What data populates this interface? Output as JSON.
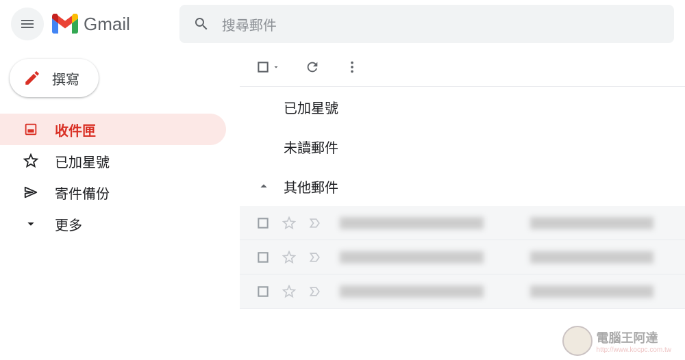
{
  "header": {
    "app_name": "Gmail",
    "search_placeholder": "搜尋郵件"
  },
  "compose_label": "撰寫",
  "sidebar": {
    "items": [
      {
        "label": "收件匣"
      },
      {
        "label": "已加星號"
      },
      {
        "label": "寄件備份"
      },
      {
        "label": "更多"
      }
    ]
  },
  "sections": {
    "starred": "已加星號",
    "unread": "未讀郵件",
    "other": "其他郵件"
  },
  "watermark": {
    "title": "電腦王阿達",
    "url": "http://www.kocpc.com.tw"
  }
}
